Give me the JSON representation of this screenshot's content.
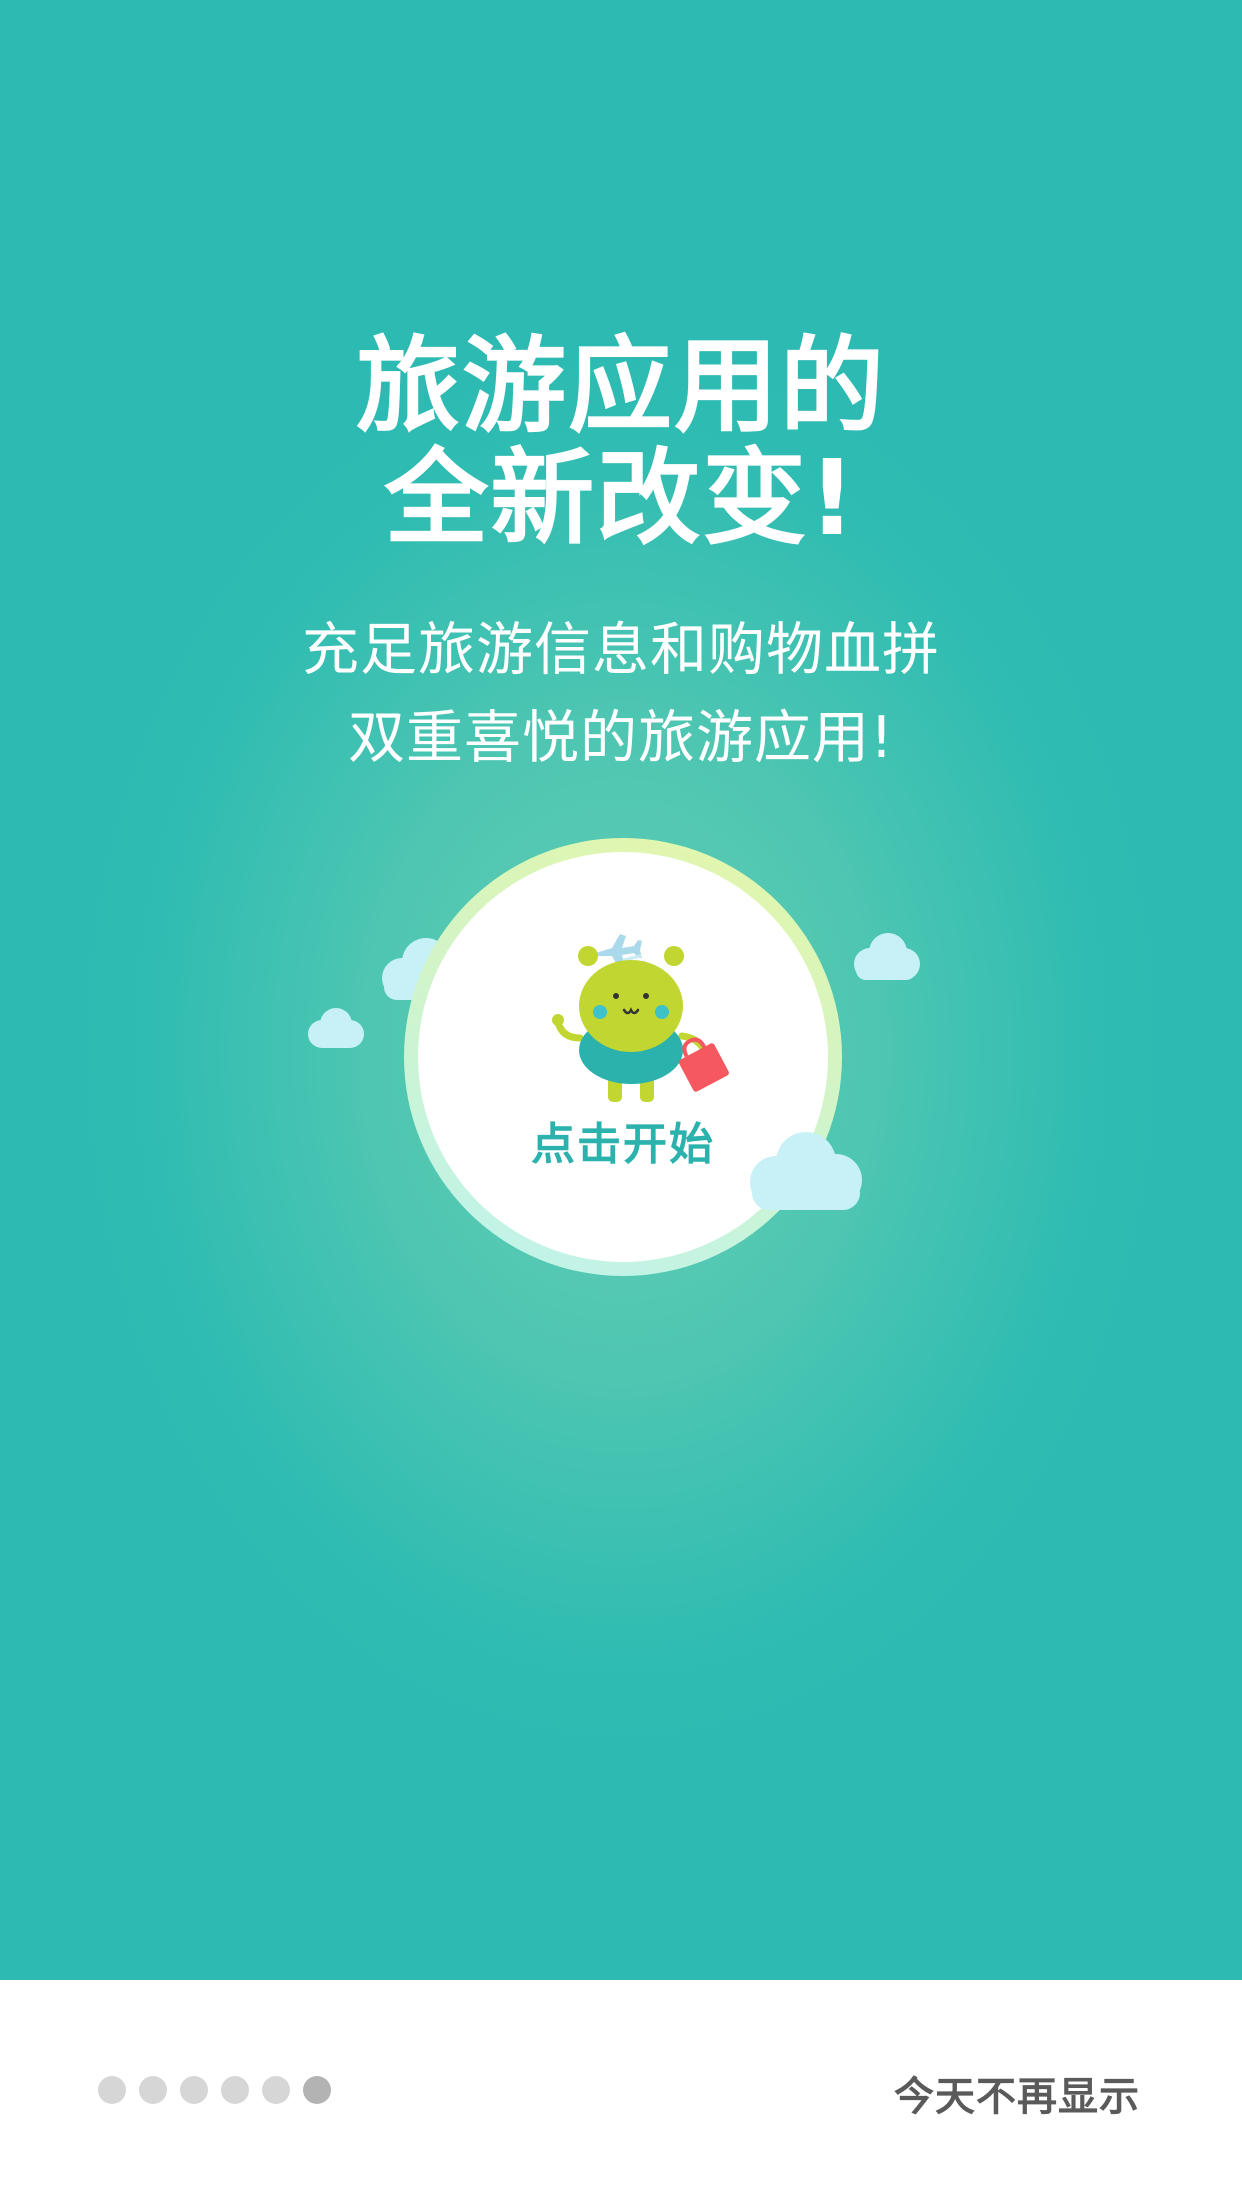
{
  "colors": {
    "background_teal": "#2cbab3",
    "background_center": "#63ceb4",
    "start_label": "#2cb2ac",
    "mascot_head": "#c1d631",
    "mascot_body": "#2bb2ac",
    "bag": "#f5585e",
    "cloud": "#c7f1f7",
    "dot_inactive": "#d6d6d6",
    "dot_active": "#b3b3b3",
    "footer_text": "#5a5a5a"
  },
  "hero": {
    "headline_line1": "旅游应用的",
    "headline_line2": "全新改变!",
    "subline_line1": "充足旅游信息和购物血拼",
    "subline_line2": "双重喜悦的旅游应用!"
  },
  "start": {
    "label": "点击开始",
    "icons": [
      "airplane-icon",
      "mascot-icon",
      "shopping-bag-icon"
    ]
  },
  "pager": {
    "total": 6,
    "active_index": 5
  },
  "footer": {
    "dont_show_today": "今天不再显示"
  }
}
